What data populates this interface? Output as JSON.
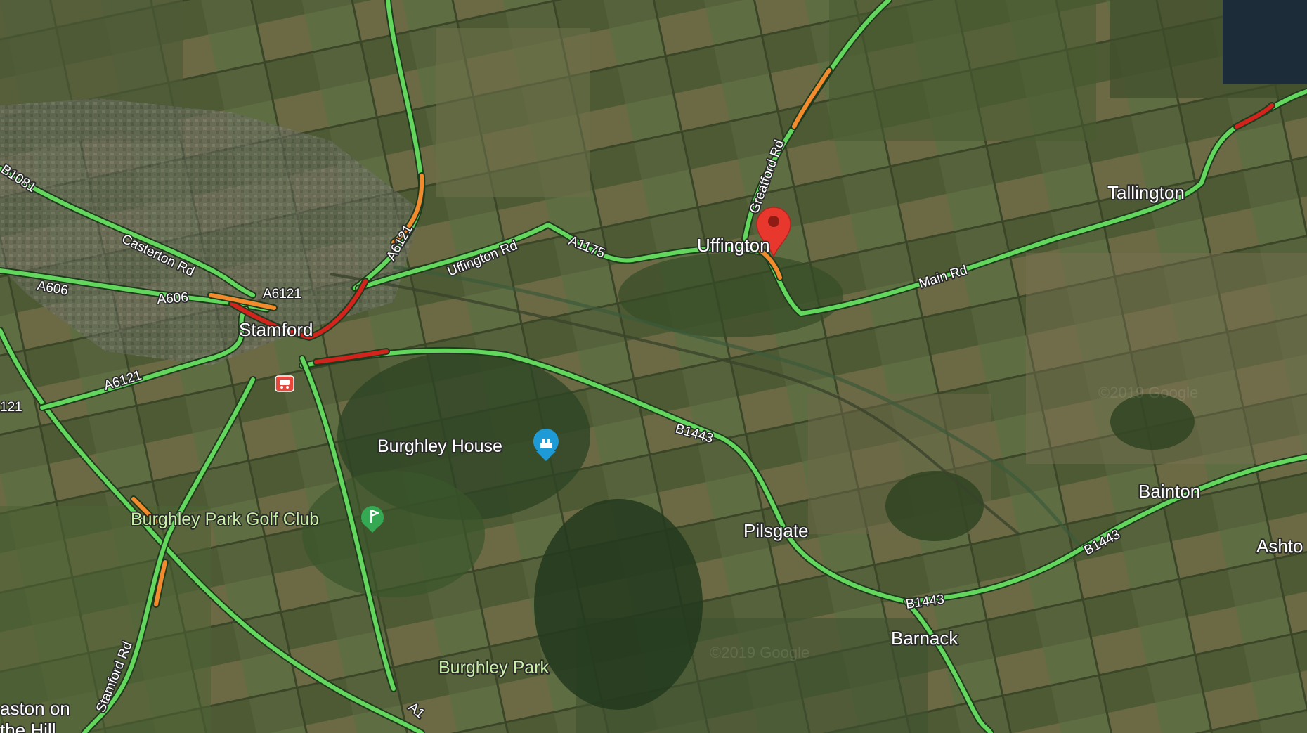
{
  "map": {
    "view": "satellite",
    "traffic_layer": true,
    "watermark": "©2019 Google",
    "colors": {
      "traffic_green": "#63d65d",
      "traffic_orange": "#f28a2e",
      "traffic_red": "#d2231c",
      "road_casing": "#1f3a1c",
      "pin": "#e8382e"
    },
    "places": {
      "stamford": "Stamford",
      "uffington": "Uffington",
      "tallington": "Tallington",
      "pilsgate": "Pilsgate",
      "barnack": "Barnack",
      "bainton": "Bainton",
      "ashton": "Ashto",
      "easton_line1": "aston on",
      "easton_line2": "the Hill"
    },
    "roads": {
      "b1081": "B1081",
      "casterton_rd": "Casterton Rd",
      "a606_west": "A606",
      "a606_east": "A606",
      "a6121_north": "A6121",
      "a6121_centre": "A6121",
      "a6121_southwest": "A6121",
      "a6121_edge": "121",
      "uffington_rd": "Uffington Rd",
      "a1175": "A1175",
      "greatford_rd": "Greatford Rd",
      "main_rd": "Main Rd",
      "b1443_west": "B1443",
      "b1443_barnack": "B1443",
      "b1443_east": "B1443",
      "stamford_rd": "Stamford Rd",
      "a1": "A1"
    },
    "pois": {
      "burghley_house": "Burghley House",
      "burghley_golf": "Burghley Park Golf Club",
      "burghley_park": "Burghley Park"
    },
    "icons": {
      "pin": "location-pin-icon",
      "landmark": "landmark-icon",
      "golf": "golf-icon",
      "rail": "train-station-icon"
    }
  }
}
